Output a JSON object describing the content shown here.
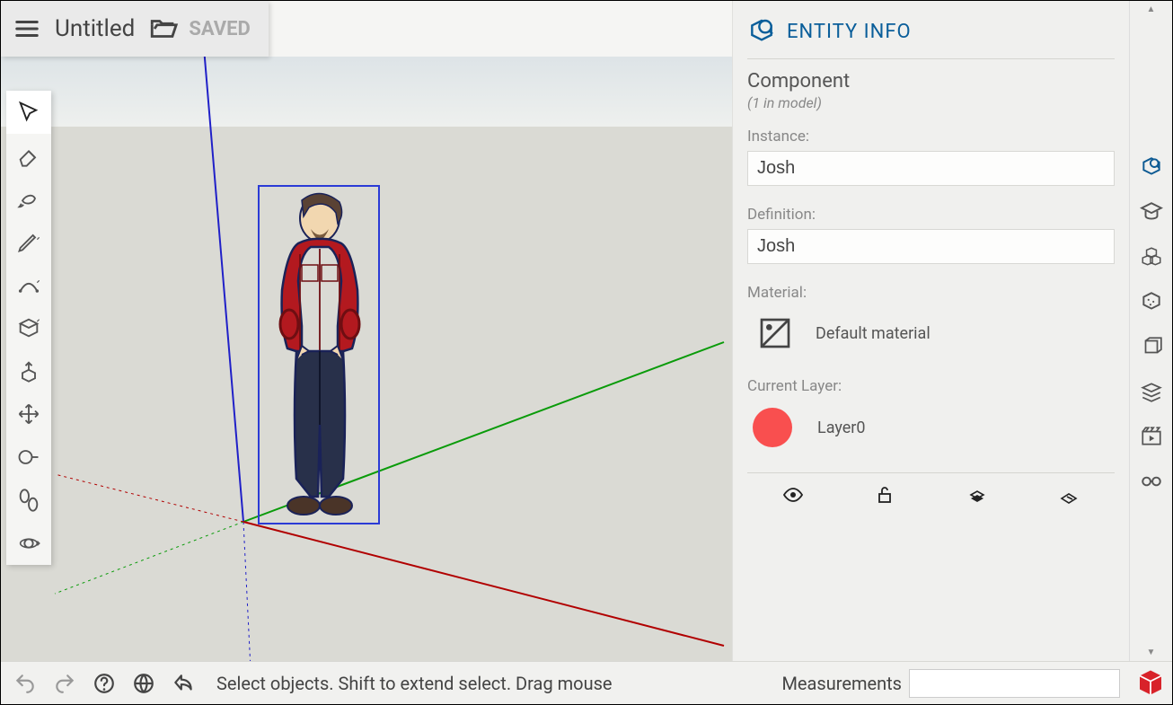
{
  "header": {
    "title": "Untitled",
    "save_status": "SAVED"
  },
  "panel": {
    "title": "ENTITY INFO",
    "type_heading": "Component",
    "type_sub": "(1 in model)",
    "instance_label": "Instance:",
    "instance_value": "Josh",
    "definition_label": "Definition:",
    "definition_value": "Josh",
    "material_label": "Material:",
    "material_value": "Default material",
    "layer_label": "Current Layer:",
    "layer_value": "Layer0",
    "layer_color": "#f94f4f"
  },
  "status": {
    "hint": "Select objects. Shift to extend select. Drag mouse",
    "measurements_label": "Measurements",
    "measurements_value": ""
  }
}
